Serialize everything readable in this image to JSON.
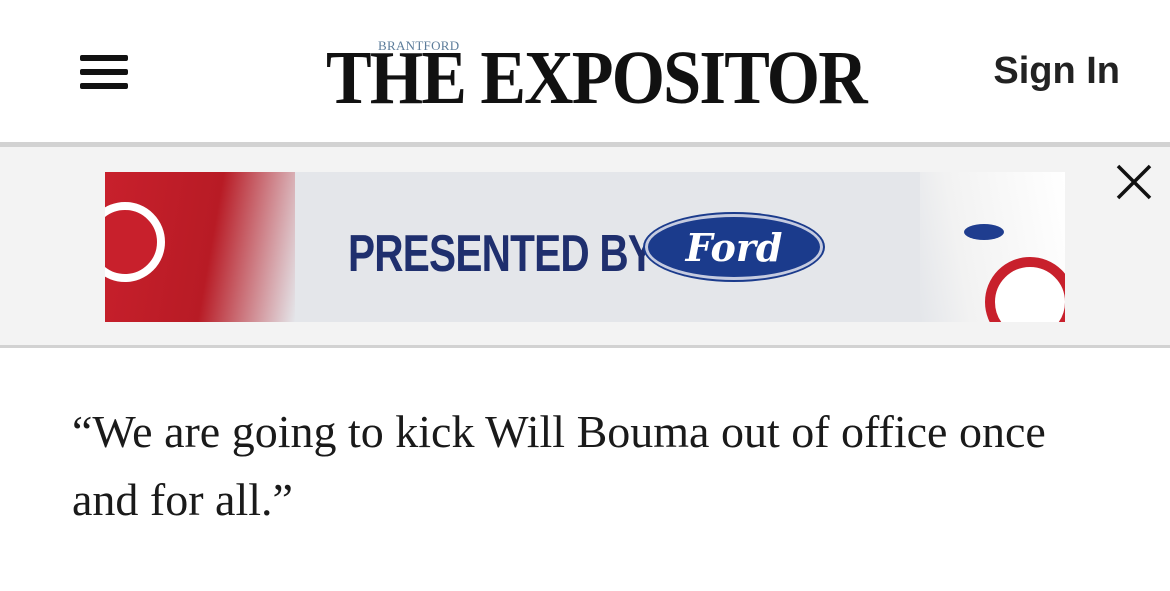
{
  "header": {
    "menu_icon": "hamburger-menu-icon",
    "logo_small": "BRANTFORD",
    "logo_main": "THE EXPOSITOR",
    "sign_in": "Sign In"
  },
  "ad": {
    "presented_by": "PRESENTED BY",
    "sponsor": "Ford",
    "close_icon": "close-x-icon"
  },
  "article": {
    "quote": "“We are going to kick Will Bouma out of office once and for all.”"
  },
  "colors": {
    "ad_navy": "#1f2f6e",
    "ford_blue": "#1b3b8c",
    "habs_red": "#c8202c"
  }
}
